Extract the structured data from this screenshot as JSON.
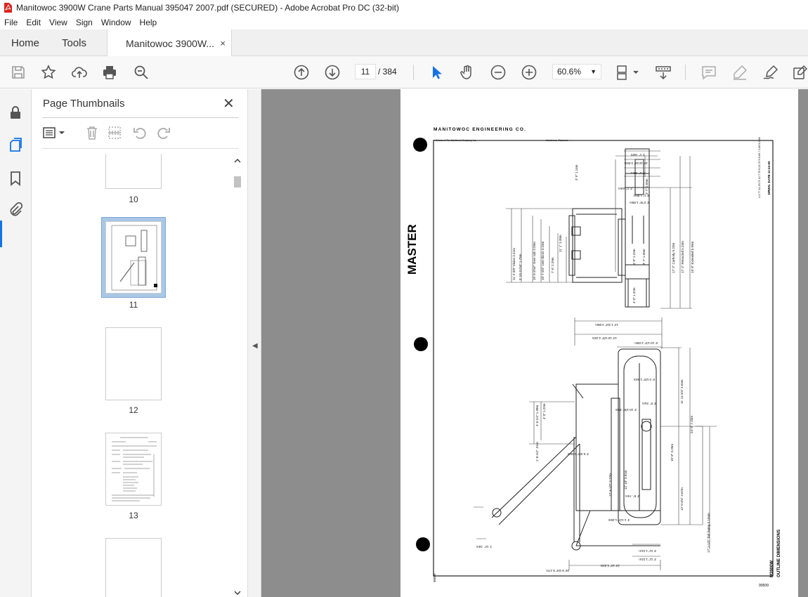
{
  "window": {
    "title": "Manitowoc 3900W Crane Parts Manual 395047 2007.pdf (SECURED) - Adobe Acrobat Pro DC (32-bit)"
  },
  "menu": [
    "File",
    "Edit",
    "View",
    "Sign",
    "Window",
    "Help"
  ],
  "tabs": {
    "home": "Home",
    "tools": "Tools",
    "document": "Manitowoc 3900W...",
    "close": "×"
  },
  "toolbar": {
    "current_page": "11",
    "total_pages": "/ 384",
    "zoom": "60.6%"
  },
  "panel": {
    "title": "Page Thumbnails",
    "close": "✕",
    "thumbnails": [
      {
        "label": "10"
      },
      {
        "label": "11"
      },
      {
        "label": "12"
      },
      {
        "label": "13"
      }
    ]
  },
  "drawing": {
    "company": "MANITOWOC ENGINEERING CO.",
    "division": "A Division of The Manitowoc Company, Inc.",
    "location": "Manitowoc, Wisconsin",
    "stamp": "MASTER",
    "sheet_title": "OUTLINE DIMENSIONS",
    "model": "M3900W",
    "drawing_no": "90509",
    "drawing_no_left": "90509",
    "dwg_date": "DRWG. DATE 11-24-65",
    "revisions": "2-3-77  12-29-71  12-7-70  9-21-70  9-9-69  7-1-68  8-3-66",
    "dims_top": [
      "3' 1\" .94m",
      "10' 11/16\" 3.06m",
      "3' 1\" .94m",
      "6' 1\" 1.85m",
      "6' 2\"/6\" 1.88m",
      "3' 9\" 1.14m",
      "2' 1\" .64m"
    ],
    "dims_left": [
      "11' 2-3/8\" Vision 3.41m",
      "5' 10-11/16\" 1.79m",
      "10' 8-3/16\" Over cab 3.26m",
      "10' 7-3/4\" over doors 3.24m",
      "7' 6\" 2.29m",
      "11' 1\" 3.38m",
      "4' 0\" 1.22m"
    ],
    "dims_right": [
      "17' 2\" Carbody 5.23m",
      "17' 2\" Retracted 5.23m",
      "19' 8\" Extended 5.99m",
      "3' 7\" 1.09m",
      "3' 7\" 1.09m",
      "4' 0\" 1.22m"
    ],
    "dims_plan": [
      "13' 1-3/4\" 3.99m",
      "13' 10-1/8\" 4.22m",
      "6' 10-1/4\" 2.09m",
      "6' 4-1/8\" 1.94m",
      "11' 11-3/4\" 3.64m",
      "10' 8\" 3.25m",
      "24' 0\" 7.32m",
      "12' 0-3/4\" 3.67m",
      "17' 1-1/2\" Tail Swing 5.194m",
      "12' 4-1/2\" 3.77m",
      "12' 10\" 3.91m",
      "4' 6-1/4\" 1.38m",
      "4' 0\" 1.22m",
      "1' 8-1/4\" .51m",
      "26' 9-3/4\" 8.17m",
      "13' 10\" 4.22m",
      "3' 11\" 1.21m",
      "3' 11\" 1.21m",
      "1' 11\" .34m",
      "2' 10-1/8\" .87m",
      "3' 0\" .91m",
      "2' 5\" .74m",
      "4' 1-1/2\" 1.26m",
      "3' 5-3/4\" 1.06m"
    ]
  }
}
